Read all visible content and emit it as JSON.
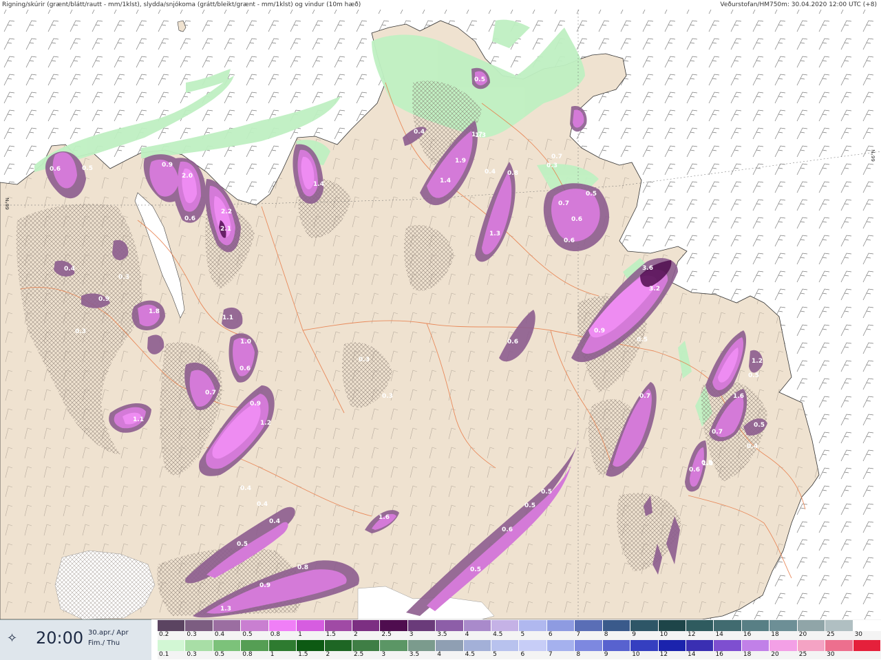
{
  "header": {
    "left_title": "Rigning/skúrir (grænt/blátt/rautt - mm/1klst), slydda/snjókoma (grátt/bleikt/grænt - mm/1klst) og vindur (10m hæð)",
    "right_title": "Veðurstofan/HM750m: 30.04.2020 12:00 UTC (+8)"
  },
  "map": {
    "lat_label_left": "66°N",
    "lat_label_right": "66°N",
    "colors": {
      "land": "#efe2d0",
      "sea": "#ffffff",
      "rain": "#bff0c2",
      "snow_light": "#8d5e8f",
      "snow_mid": "#d47ad8",
      "snow_heavy": "#ee8cf2",
      "roads": "#e8804e",
      "hatch": "#7c6f66"
    },
    "values": [
      {
        "t": "0.6"
      },
      {
        "t": "0.5"
      },
      {
        "t": "0.9"
      },
      {
        "t": "2.0"
      },
      {
        "t": "2.2"
      },
      {
        "t": "2.1"
      },
      {
        "t": "0.6"
      },
      {
        "t": "1.4"
      },
      {
        "t": "0.4"
      },
      {
        "t": "1.9"
      },
      {
        "t": "0.4"
      },
      {
        "t": "1.3"
      },
      {
        "t": "0.8"
      },
      {
        "t": "0.7"
      },
      {
        "t": "0.3"
      },
      {
        "t": "0.7"
      },
      {
        "t": "0.6"
      },
      {
        "t": "0.4"
      },
      {
        "t": "0.3"
      },
      {
        "t": "0.9"
      },
      {
        "t": "1.8"
      },
      {
        "t": "0.3"
      },
      {
        "t": "1.1"
      },
      {
        "t": "1.0"
      },
      {
        "t": "0.6"
      },
      {
        "t": "0.7"
      },
      {
        "t": "0.9"
      },
      {
        "t": "1.2"
      },
      {
        "t": "1.1"
      },
      {
        "t": "0.3"
      },
      {
        "t": "0.3"
      },
      {
        "t": "0.4"
      },
      {
        "t": "0.4"
      },
      {
        "t": "0.4"
      },
      {
        "t": "0.5"
      },
      {
        "t": "1.6"
      },
      {
        "t": "0.8"
      },
      {
        "t": "0.9"
      },
      {
        "t": "1.3"
      },
      {
        "t": "0.6"
      },
      {
        "t": "0.5"
      },
      {
        "t": "0.5"
      },
      {
        "t": "0.6"
      },
      {
        "t": "3.6"
      },
      {
        "t": "3.2"
      },
      {
        "t": "0.9"
      },
      {
        "t": "0.5"
      },
      {
        "t": "0.7"
      },
      {
        "t": "0.6"
      },
      {
        "t": "1.3"
      },
      {
        "t": "1.6"
      },
      {
        "t": "0.7"
      },
      {
        "t": "0.5"
      },
      {
        "t": "0.4"
      },
      {
        "t": "0.6"
      },
      {
        "t": "1.0"
      },
      {
        "t": "0.5"
      },
      {
        "t": "1.2"
      },
      {
        "t": "0.5"
      },
      {
        "t": "0.5"
      },
      {
        "t": "1.7"
      },
      {
        "t": "0.5"
      },
      {
        "t": "1.4"
      },
      {
        "t": "0.5"
      }
    ]
  },
  "timebox": {
    "time": "20:00",
    "date_line1": "30.apr./ Apr",
    "date_line2": "Fim./ Thu",
    "icon": "sun-icon"
  },
  "legend": {
    "row1": {
      "colors": [
        "#5b4461",
        "#7c5d81",
        "#9b6ea1",
        "#c97fd1",
        "#f07ff7",
        "#d65de0",
        "#a04aa5",
        "#7c2f82",
        "#4f0d4f",
        "#6a3b7a",
        "#8d5ea8",
        "#a98acb",
        "#c5b2e6",
        "#b0b8ef",
        "#8e9be1",
        "#5a6eb6",
        "#3a5a8b",
        "#2e5667",
        "#1e4549",
        "#2f5b5f",
        "#416b70",
        "#587f85",
        "#6d8f96",
        "#90a5a8",
        "#b0bfc2",
        "#ffffff"
      ],
      "labels": [
        "0.2",
        "0.3",
        "0.4",
        "0.5",
        "0.8",
        "1",
        "1.5",
        "2",
        "2.5",
        "3",
        "3.5",
        "4",
        "4.5",
        "5",
        "6",
        "7",
        "8",
        "9",
        "10",
        "12",
        "14",
        "16",
        "18",
        "20",
        "25",
        "30"
      ]
    },
    "row2": {
      "colors": [
        "#d2f7d4",
        "#a8dea6",
        "#7cc27a",
        "#559e54",
        "#2e7b30",
        "#0d5a13",
        "#1e6624",
        "#3f7e45",
        "#5b9665",
        "#7b9b8d",
        "#8f9fb3",
        "#a3b0d8",
        "#b8c2ee",
        "#c7cdf7",
        "#a5b1ee",
        "#7d88e0",
        "#5862cf",
        "#353fc0",
        "#1b23ad",
        "#3a2fb2",
        "#7e4fd0",
        "#c180e8",
        "#f3a0e6",
        "#f4a3c4",
        "#ed6f8e",
        "#e5203b"
      ],
      "labels": [
        "0.1",
        "0.3",
        "0.5",
        "0.8",
        "1",
        "1.5",
        "2",
        "2.5",
        "3",
        "3.5",
        "4",
        "4.5",
        "5",
        "6",
        "7",
        "8",
        "9",
        "10",
        "12",
        "14",
        "16",
        "18",
        "20",
        "25",
        "30"
      ]
    }
  }
}
